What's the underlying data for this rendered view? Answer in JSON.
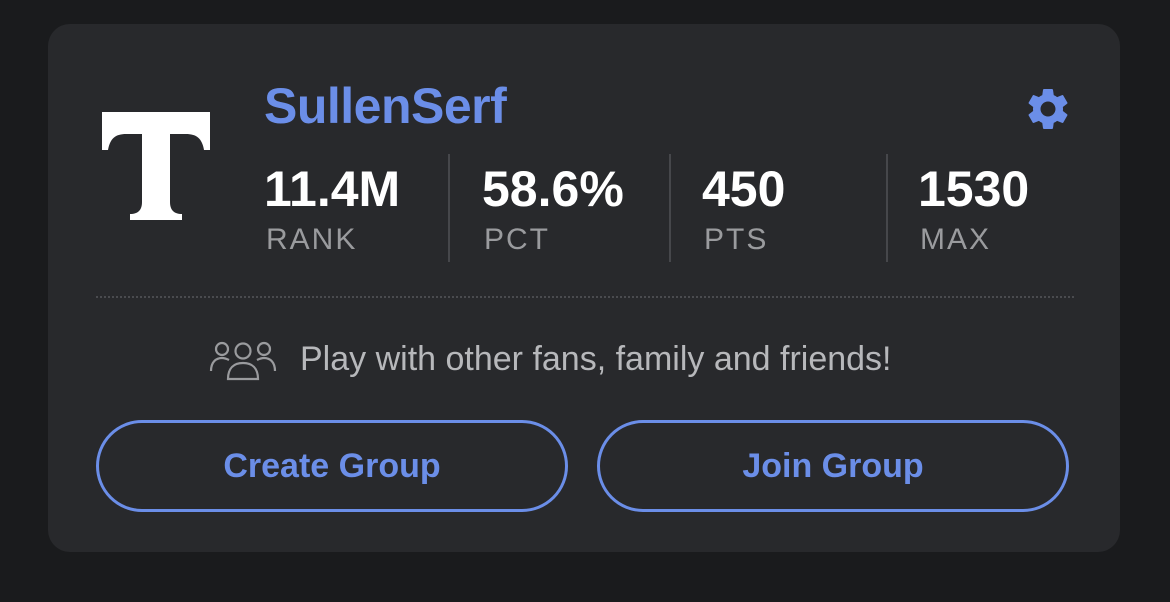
{
  "profile": {
    "logo_letter": "T",
    "username": "SullenSerf"
  },
  "stats": [
    {
      "value": "11.4M",
      "label": "RANK"
    },
    {
      "value": "58.6%",
      "label": "PCT"
    },
    {
      "value": "450",
      "label": "PTS"
    },
    {
      "value": "1530",
      "label": "MAX"
    }
  ],
  "groups": {
    "promo_text": "Play with other fans, family and friends!",
    "create_label": "Create Group",
    "join_label": "Join Group"
  },
  "icons": {
    "settings": "gear-icon",
    "groups": "people-group-icon"
  },
  "colors": {
    "accent": "#6b8ee8",
    "card_bg": "#28292c",
    "page_bg": "#1a1b1d",
    "label": "#9a9b9e"
  }
}
